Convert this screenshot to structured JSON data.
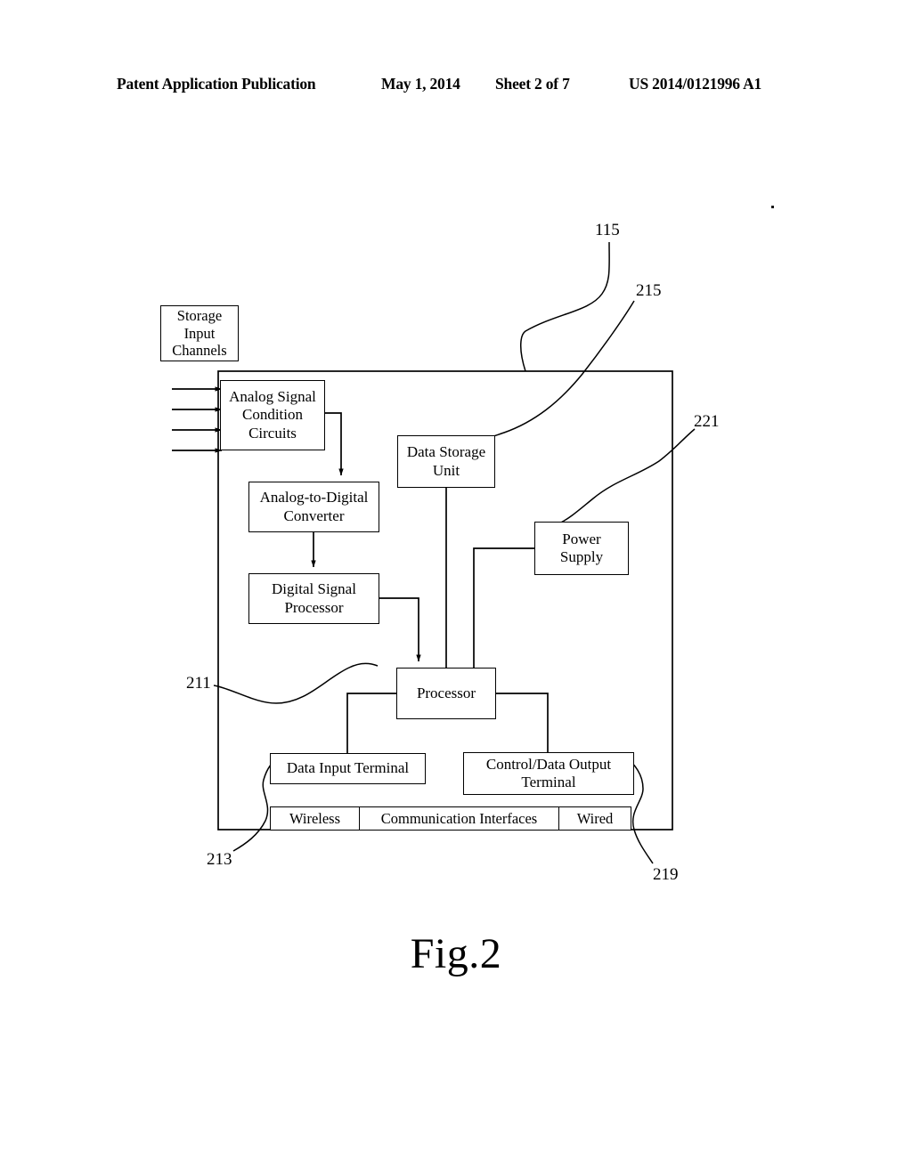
{
  "header": {
    "publication": "Patent Application Publication",
    "date": "May 1, 2014",
    "sheet": "Sheet 2 of 7",
    "patent_number": "US 2014/0121996 A1"
  },
  "figure": {
    "caption": "Fig.2",
    "blocks": {
      "storage_input_channels": "Storage\nInput\nChannels",
      "analog_signal_condition_circuits": "Analog Signal\nCondition\nCircuits",
      "analog_to_digital_converter": "Analog-to-Digital\nConverter",
      "digital_signal_processor": "Digital Signal\nProcessor",
      "data_storage_unit": "Data Storage\nUnit",
      "power_supply": "Power\nSupply",
      "processor": "Processor",
      "data_input_terminal": "Data Input Terminal",
      "control_data_output_terminal": "Control/Data Output\nTerminal"
    },
    "communication_interfaces": {
      "wireless": "Wireless",
      "title": "Communication Interfaces",
      "wired": "Wired"
    },
    "reference_numerals": {
      "outer_enclosure": "115",
      "data_storage_unit": "215",
      "power_supply": "221",
      "processor": "211",
      "data_input_terminal": "213",
      "control_data_output_terminal": "219"
    }
  },
  "colors": {
    "ink": "#000000",
    "paper": "#ffffff"
  }
}
